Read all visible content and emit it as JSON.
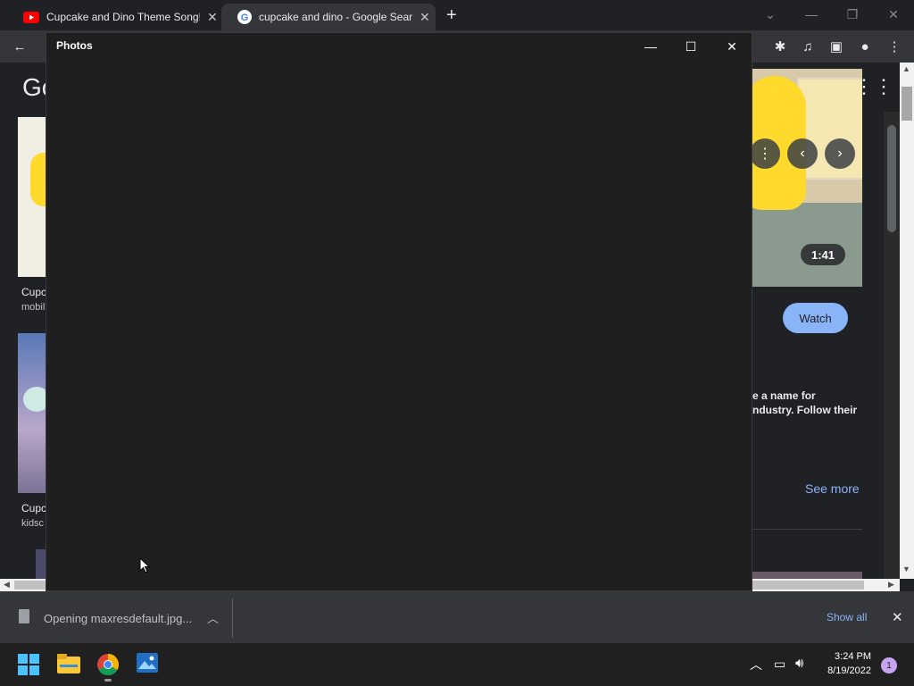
{
  "browser": {
    "tabs": [
      {
        "title": "Cupcake and Dino Theme Song! | D",
        "favicon": "youtube-icon",
        "active": false
      },
      {
        "title": "cupcake and dino - Google Search",
        "favicon": "google-icon",
        "active": true
      }
    ],
    "new_tab": "+",
    "google_logo_partial": "Go"
  },
  "page": {
    "left_results": [
      {
        "title": "Cupc",
        "source": "mobil"
      },
      {
        "title": "Cupc",
        "source": "kidsc"
      }
    ],
    "video_duration": "1:41",
    "watch_label": "Watch",
    "description_lines": [
      "e a name for",
      "ndustry. Follow their"
    ],
    "see_more": "See more"
  },
  "photos_window": {
    "title": "Photos"
  },
  "download_bar": {
    "file_text": "Opening maxresdefault.jpg...",
    "show_all": "Show all"
  },
  "taskbar": {
    "time": "3:24 PM",
    "date": "8/19/2022",
    "notification_count": "1"
  },
  "colors": {
    "accent_blue": "#8ab4f8",
    "window_bg": "#1f1f1f",
    "chrome_dark": "#202124"
  }
}
